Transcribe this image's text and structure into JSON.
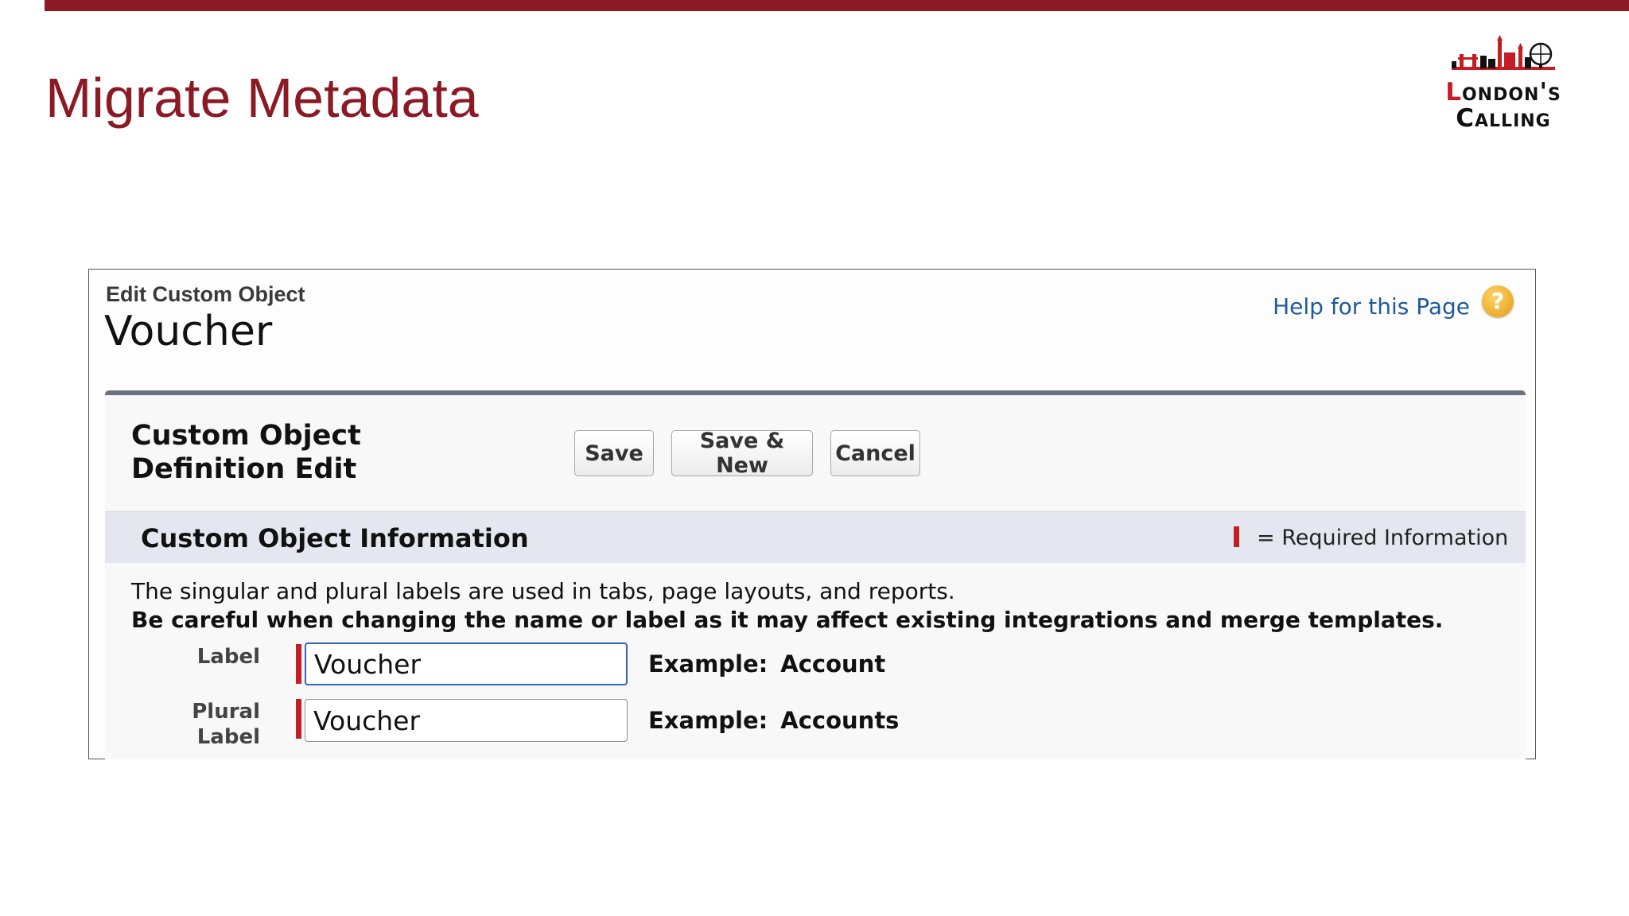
{
  "slide": {
    "title": "Migrate Metadata",
    "logo": {
      "line1_red": "L",
      "line1_rest": "ondon's",
      "line2": "Calling"
    },
    "colors": {
      "accent": "#8b1a24",
      "required": "#c41e24",
      "link": "#1f5a9a"
    }
  },
  "page": {
    "eyebrow": "Edit Custom Object",
    "object_name": "Voucher",
    "help_link": "Help for this Page",
    "help_icon": "?"
  },
  "edit": {
    "section_title": "Custom Object Definition Edit",
    "buttons": {
      "save": "Save",
      "save_new": "Save & New",
      "cancel": "Cancel"
    }
  },
  "info": {
    "title": "Custom Object Information",
    "required_legend": "= Required Information",
    "description": "The singular and plural labels are used in tabs, page layouts, and reports.",
    "warning": "Be careful when changing the name or label as it may affect existing integrations and merge templates."
  },
  "fields": {
    "label": {
      "name": "Label",
      "value": "Voucher",
      "example_prefix": "Example:",
      "example_value": "Account"
    },
    "plural_label": {
      "name": "Plural Label",
      "value": "Voucher",
      "example_prefix": "Example:",
      "example_value": "Accounts"
    }
  }
}
